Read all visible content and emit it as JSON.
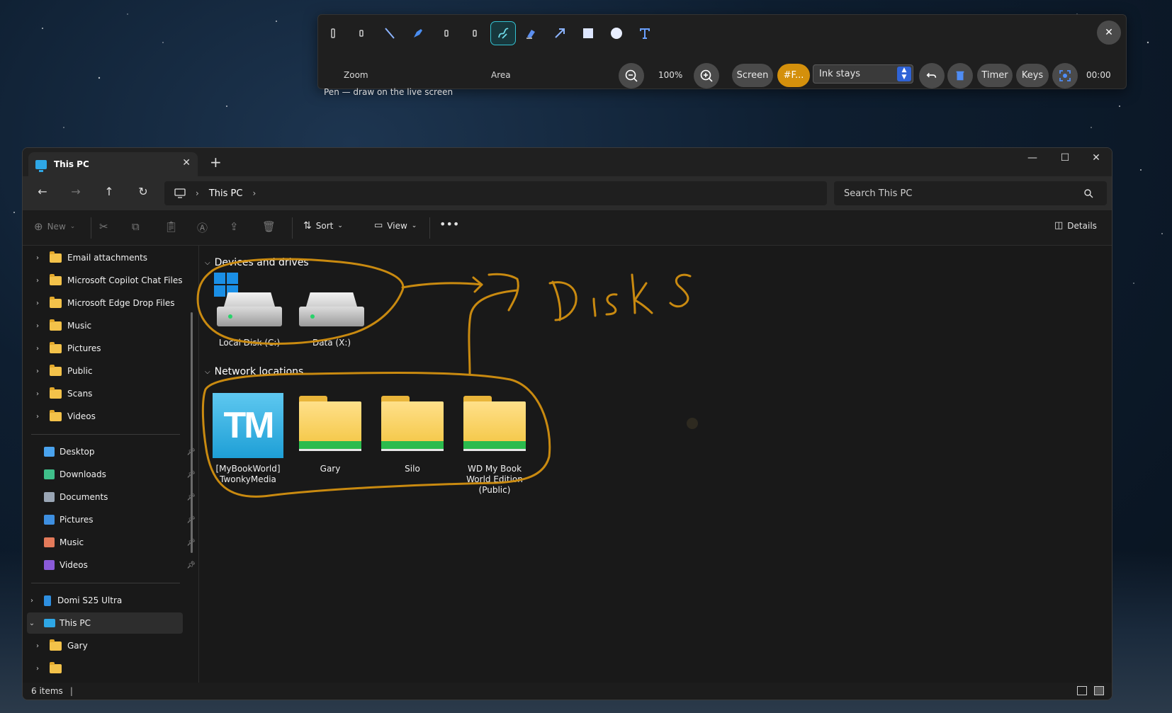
{
  "toolbar": {
    "zoom_label": "Zoom",
    "area_label": "Area",
    "status": "Pen — draw on the live screen",
    "zoom_level": "100%",
    "screen_label": "Screen",
    "color_label": "#F...",
    "ink_mode": "Ink stays",
    "timer_label": "Timer",
    "keys_label": "Keys",
    "time": "00:00",
    "accent_color": "#d4900c",
    "tools": [
      "small-tool-icon",
      "small-tool-icon",
      "line-icon",
      "marker-icon",
      "small-tool-icon",
      "small-tool-icon",
      "pen-icon",
      "highlighter-icon",
      "arrow-icon",
      "rectangle-icon",
      "ellipse-icon",
      "text-icon"
    ]
  },
  "window": {
    "tab_title": "This PC",
    "breadcrumb": "This PC",
    "search_placeholder": "Search This PC",
    "cmd": {
      "new": "New",
      "sort": "Sort",
      "view": "View",
      "details": "Details"
    },
    "sidebar": {
      "folders": [
        "Email attachments",
        "Microsoft Copilot Chat Files",
        "Microsoft Edge Drop Files",
        "Music",
        "Pictures",
        "Public",
        "Scans",
        "Videos"
      ],
      "quick": [
        "Desktop",
        "Downloads",
        "Documents",
        "Pictures",
        "Music",
        "Videos"
      ],
      "devices": [
        "Domi S25 Ultra",
        "This PC",
        "Gary"
      ]
    },
    "groups": {
      "drives": "Devices and drives",
      "network": "Network locations"
    },
    "drives": [
      "Local Disk (C:)",
      "Data (X:)"
    ],
    "network": [
      "[MyBookWorld]\nTwonkyMedia",
      "Gary",
      "Silo",
      "WD My Book\nWorld Edition\n(Public)"
    ],
    "network_tile_text": "TM",
    "status": "6 items"
  },
  "annotation": {
    "handwritten_text": "Disks",
    "ink_color": "#c98a10"
  }
}
